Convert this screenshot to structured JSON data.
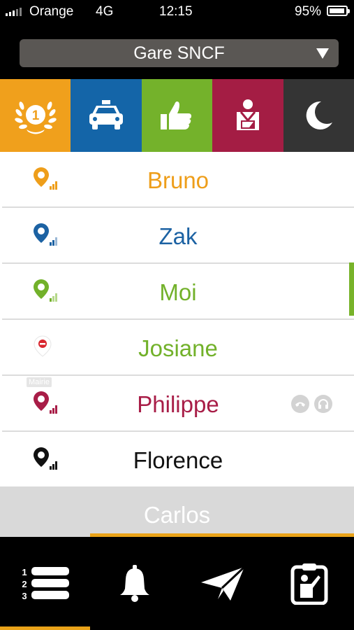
{
  "status_bar": {
    "carrier": "Orange",
    "network": "4G",
    "time": "12:15",
    "battery": "95%",
    "battery_level": 0.95
  },
  "station_selector": {
    "value": "Gare SNCF"
  },
  "tiles": [
    {
      "icon": "laurel-rank-icon",
      "label": "1",
      "color": "#f0a01c"
    },
    {
      "icon": "taxi-icon",
      "color": "#1465a8"
    },
    {
      "icon": "thumbs-up-icon",
      "color": "#74b22b"
    },
    {
      "icon": "driver-person-icon",
      "color": "#a41d44"
    },
    {
      "icon": "moon-icon",
      "color": "#343434"
    }
  ],
  "drivers": [
    {
      "name": "Bruno",
      "color": "#ee9e1a",
      "status": "location-signal"
    },
    {
      "name": "Zak",
      "color": "#1c62a3",
      "status": "location-signal"
    },
    {
      "name": "Moi",
      "color": "#72b12a",
      "status": "location-signal",
      "selected": true
    },
    {
      "name": "Josiane",
      "color": "#72b12a",
      "status": "no-entry"
    },
    {
      "name": "Philippe",
      "color": "#a81d47",
      "status": "location-signal",
      "tag": "Mairie"
    },
    {
      "name": "Florence",
      "color": "#111111",
      "status": "location-signal"
    }
  ],
  "carlos": {
    "name": "Carlos"
  },
  "bottom_nav": [
    {
      "icon": "ranked-list-icon",
      "numbers": [
        "1",
        "2",
        "3"
      ],
      "active": true
    },
    {
      "icon": "bell-icon"
    },
    {
      "icon": "paper-plane-icon"
    },
    {
      "icon": "clipboard-person-icon"
    }
  ]
}
